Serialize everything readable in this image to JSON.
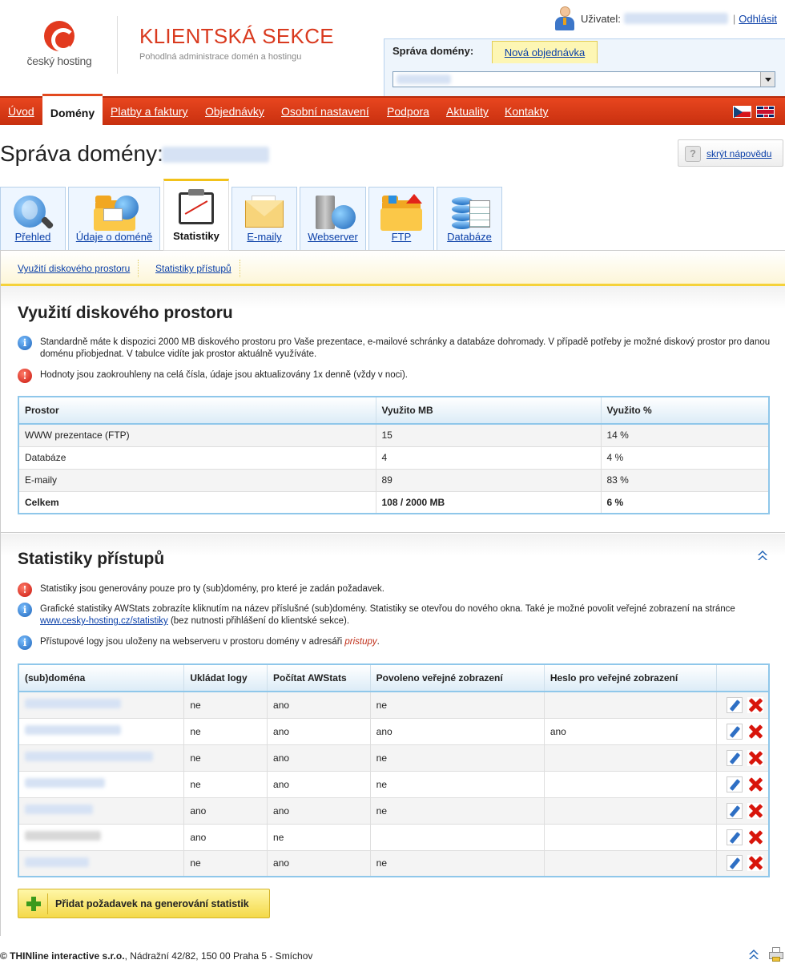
{
  "header": {
    "logo_text": "český hosting",
    "title": "KLIENTSKÁ SEKCE",
    "subtitle": "Pohodlná administrace domén a hostingu",
    "user_label": "Uživatel:",
    "user_sep": "|",
    "logout": "Odhlásit",
    "domain_tab": "Správa domény:",
    "new_order_tab": "Nová objednávka"
  },
  "menu": [
    {
      "label": "Úvod"
    },
    {
      "label": "Domény",
      "active": true
    },
    {
      "label": "Platby a faktury"
    },
    {
      "label": "Objednávky"
    },
    {
      "label": "Osobní nastavení"
    },
    {
      "label": "Podpora"
    },
    {
      "label": "Aktuality"
    },
    {
      "label": "Kontakty"
    }
  ],
  "page": {
    "title": "Správa domény:",
    "help": "skrýt nápovědu"
  },
  "tabs": [
    {
      "label": "Přehled",
      "icon": "search-icon"
    },
    {
      "label": "Údaje o doméně",
      "icon": "folder-globe-icon"
    },
    {
      "label": "Statistiky",
      "icon": "chart-board-icon",
      "active": true
    },
    {
      "label": "E-maily",
      "icon": "envelope-icon"
    },
    {
      "label": "Webserver",
      "icon": "server-icon"
    },
    {
      "label": "FTP",
      "icon": "ftp-folder-icon"
    },
    {
      "label": "Databáze",
      "icon": "database-icon"
    }
  ],
  "subnav": [
    "Využití diskového prostoru",
    "Statistiky přístupů"
  ],
  "disk": {
    "title": "Využití diskového prostoru",
    "note1": "Standardně máte k dispozici 2000 MB diskového prostoru pro Vaše prezentace, e-mailové schránky a databáze dohromady. V případě potřeby je možné diskový prostor pro danou doménu přiobjednat. V tabulce vidíte jak prostor aktuálně využíváte.",
    "note2": "Hodnoty jsou zaokrouhleny na celá čísla, údaje jsou aktualizovány 1x denně (vždy v noci).",
    "columns": [
      "Prostor",
      "Využito MB",
      "Využito %"
    ],
    "rows": [
      [
        "WWW prezentace (FTP)",
        "15",
        "14 %"
      ],
      [
        "Databáze",
        "4",
        "4 %"
      ],
      [
        "E-maily",
        "89",
        "83 %"
      ]
    ],
    "total": [
      "Celkem",
      "108 / 2000 MB",
      "6 %"
    ]
  },
  "stats": {
    "title": "Statistiky přístupů",
    "note1": "Statistiky jsou generovány pouze pro ty (sub)domény, pro které je zadán požadavek.",
    "note2a": "Grafické statistiky AWStats zobrazíte kliknutím na název příslušné (sub)domény. Statistiky se otevřou do nového okna. Také je možné povolit veřejné zobrazení na stránce ",
    "note2_link": "www.cesky-hosting.cz/statistiky",
    "note2b": " (bez nutnosti přihlášení do klientské sekce).",
    "note3a": "Přístupové logy jsou uloženy na webserveru v prostoru domény v adresáři ",
    "note3_dir": "pristupy",
    "note3b": ".",
    "columns": [
      "(sub)doména",
      "Ukládat logy",
      "Počítat AWStats",
      "Povoleno veřejné zobrazení",
      "Heslo pro veřejné zobrazení",
      ""
    ],
    "rows": [
      [
        "ne",
        "ano",
        "ne",
        ""
      ],
      [
        "ne",
        "ano",
        "ano",
        "ano"
      ],
      [
        "ne",
        "ano",
        "ne",
        ""
      ],
      [
        "ne",
        "ano",
        "ne",
        ""
      ],
      [
        "ano",
        "ano",
        "ne",
        ""
      ],
      [
        "ano",
        "ne",
        "",
        ""
      ],
      [
        "ne",
        "ano",
        "ne",
        ""
      ]
    ],
    "add_button": "Přidat požadavek na generování statistik"
  },
  "footer": {
    "company": "© THINline interactive s.r.o.",
    "address": ", Nádražní 42/82, 150 00 Praha 5 - Smíchov"
  },
  "colors": {
    "menu_red": "#d63a17",
    "title_red": "#d93a1f",
    "link_blue": "#0a3fa8",
    "table_border": "#8fc7ea",
    "accent_yellow": "#f5d23a"
  }
}
